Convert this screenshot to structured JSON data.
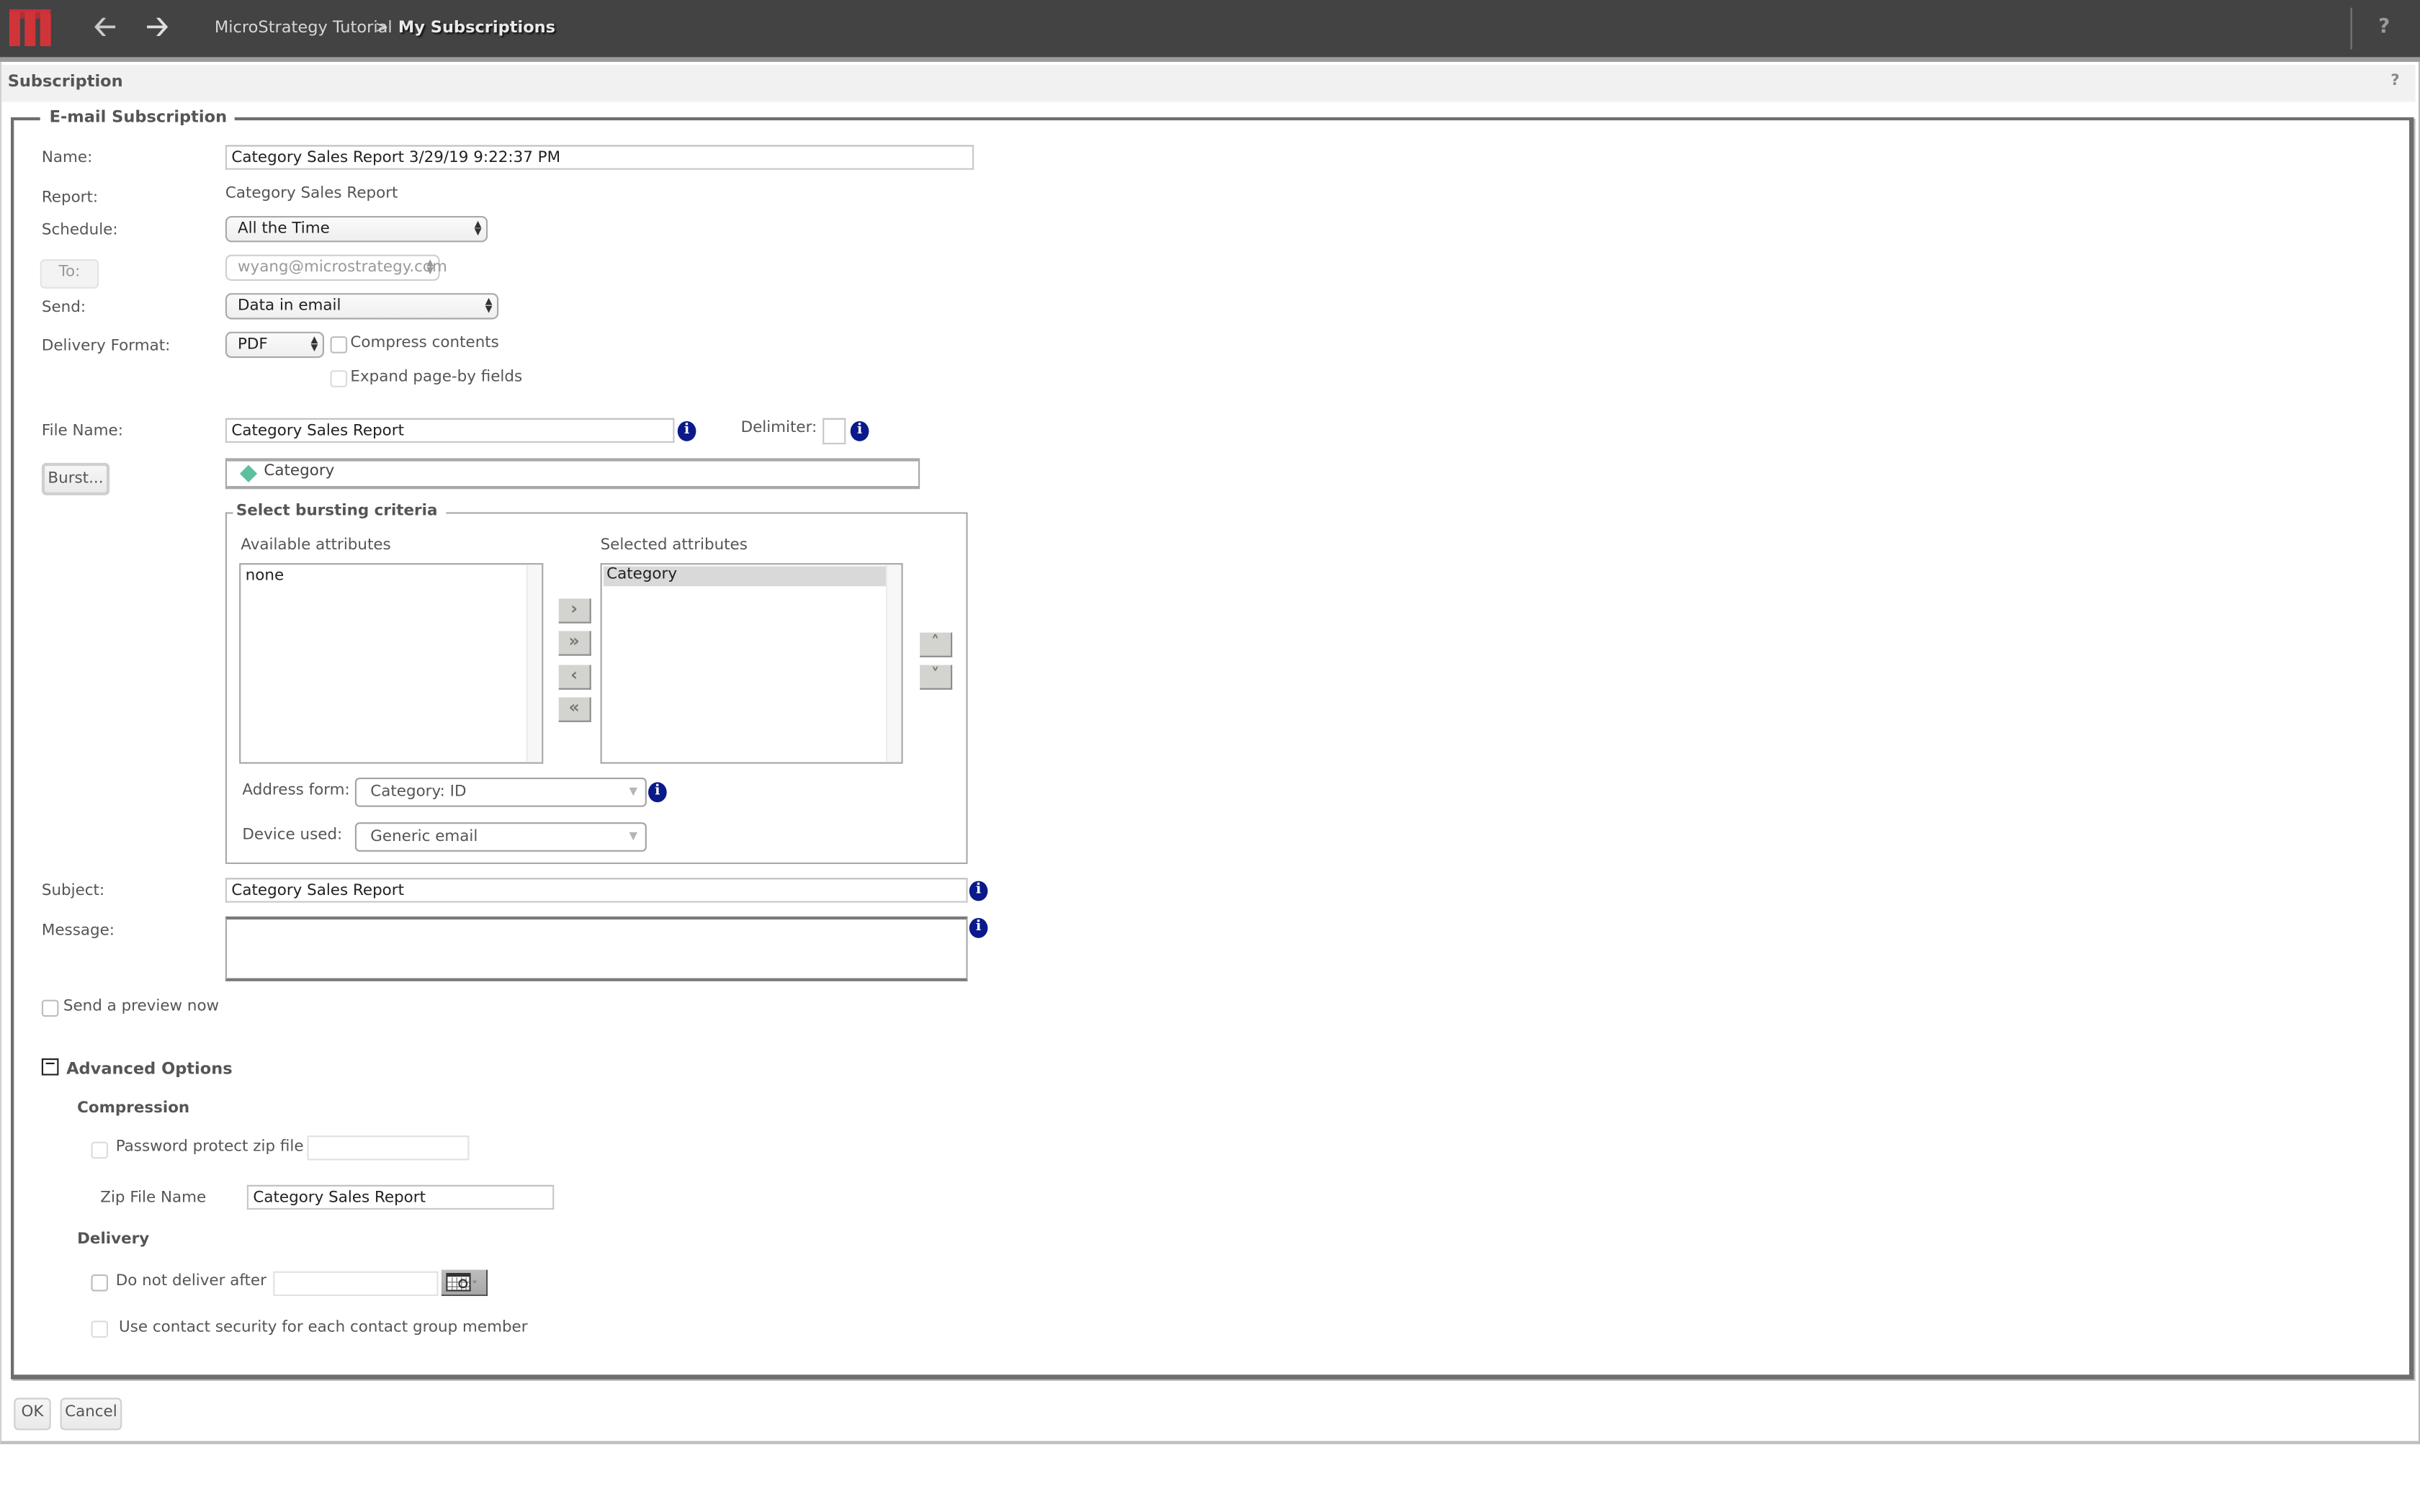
{
  "topbar": {
    "logo": "microstrategy-logo",
    "back_icon": "arrow-left-icon",
    "forward_icon": "arrow-right-icon",
    "breadcrumb": [
      "MicroStrategy Tutorial",
      "My Subscriptions"
    ],
    "breadcrumb_separator": ">",
    "help": "?"
  },
  "page": {
    "title": "Subscription",
    "help": "?"
  },
  "form": {
    "legend": "E-mail Subscription",
    "name_label": "Name:",
    "name_value": "Category Sales Report 3/29/19 9:22:37 PM",
    "report_label": "Report:",
    "report_value": "Category Sales Report",
    "schedule_label": "Schedule:",
    "schedule_value": "All the Time",
    "to_button": "To:",
    "to_value": "wyang@microstrategy.com",
    "send_label": "Send:",
    "send_value": "Data in email",
    "delivery_format_label": "Delivery Format:",
    "delivery_format_value": "PDF",
    "compress_contents_label": "Compress contents",
    "compress_contents_checked": false,
    "expand_pageby_label": "Expand page-by fields",
    "expand_pageby_checked": false,
    "file_name_label": "File Name:",
    "file_name_value": "Category Sales Report",
    "delimiter_label": "Delimiter:",
    "delimiter_value": "",
    "burst_button": "Burst...",
    "burst_value": "Category",
    "info_glyph": "i"
  },
  "bursting": {
    "legend": "Select bursting criteria",
    "available_label": "Available attributes",
    "available_items": [
      "none"
    ],
    "selected_label": "Selected attributes",
    "selected_items": [
      "Category"
    ],
    "move_buttons": {
      "add": "›",
      "add_all": "»",
      "remove": "‹",
      "remove_all": "«"
    },
    "order_buttons": {
      "up": "˄",
      "down": "˅"
    },
    "address_form_label": "Address form:",
    "address_form_value": "Category: ID",
    "device_used_label": "Device used:",
    "device_used_value": "Generic email"
  },
  "email": {
    "subject_label": "Subject:",
    "subject_value": "Category Sales Report",
    "message_label": "Message:",
    "message_value": "",
    "preview_label": "Send a preview now",
    "preview_checked": false
  },
  "advanced": {
    "toggle_glyph": "−",
    "title": "Advanced Options",
    "compression_title": "Compression",
    "password_label": "Password protect zip file",
    "password_value": "",
    "zip_name_label": "Zip File Name",
    "zip_name_value": "Category Sales Report",
    "delivery_title": "Delivery",
    "do_not_deliver_label": "Do not deliver after",
    "do_not_deliver_value": "",
    "contact_security_label": "Use contact security for each contact group member"
  },
  "footer": {
    "ok": "OK",
    "cancel": "Cancel"
  },
  "colors": {
    "topbar": "#434343",
    "logo_red": "#d13438",
    "info_blue": "#0b1a8a",
    "attribute_diamond": "#5cc0a0"
  }
}
